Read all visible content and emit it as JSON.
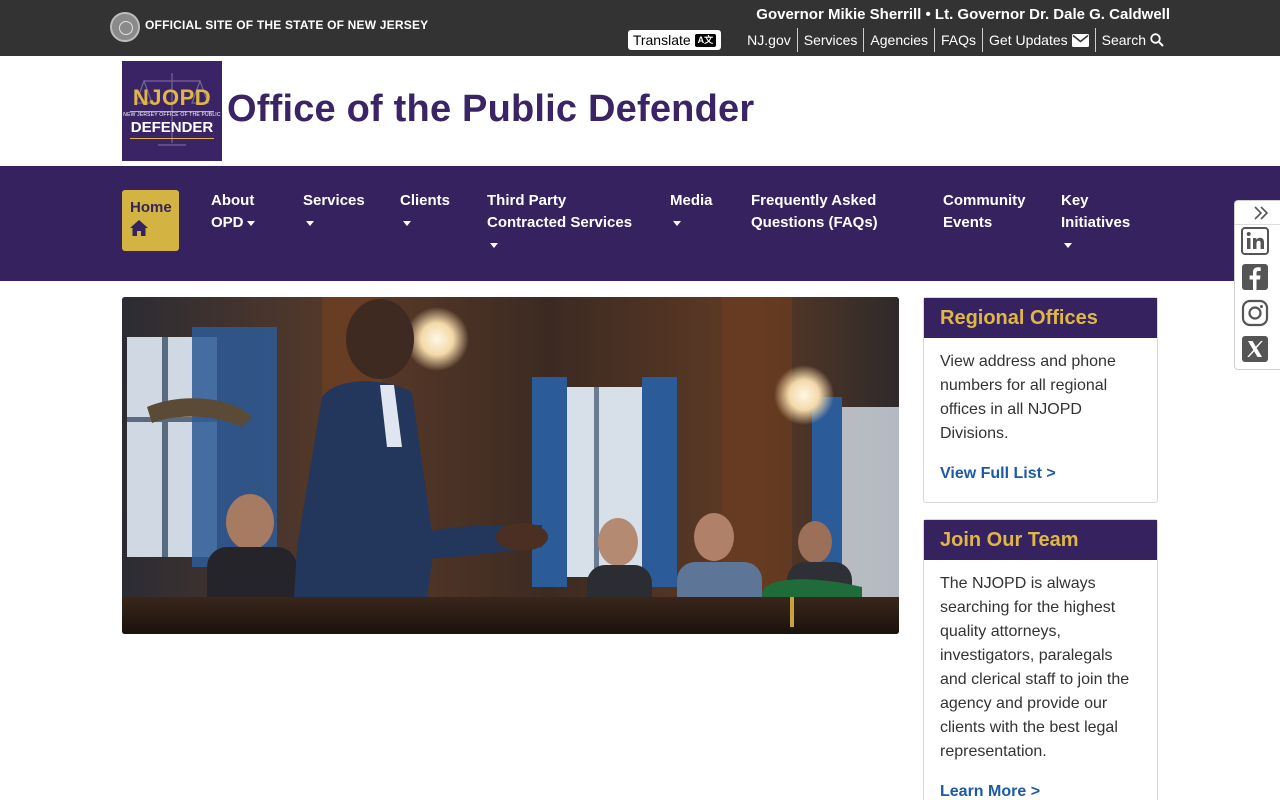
{
  "statebar": {
    "official_text": "OFFICIAL SITE OF THE STATE OF NEW JERSEY",
    "governor_text": "Governor Mikie Sherrill • Lt. Governor Dr. Dale G. Caldwell",
    "translate_label": "Translate",
    "translate_icon_text": "A文",
    "links": [
      "NJ.gov",
      "Services",
      "Agencies",
      "FAQs",
      "Get Updates",
      "Search"
    ]
  },
  "header": {
    "logo_line1": "NJOPD",
    "logo_line2": "NEW JERSEY OFFICE OF THE PUBLIC",
    "logo_line3": "DEFENDER",
    "title": "Office of the Public Defender"
  },
  "nav": {
    "home": "Home",
    "items": [
      {
        "line1": "About",
        "line2": "OPD"
      },
      {
        "line1": "Services"
      },
      {
        "line1": "Clients"
      },
      {
        "line1": "Third Party",
        "line2": "Contracted Services"
      },
      {
        "line1": "Media"
      },
      {
        "line1": "Frequently Asked",
        "line2": "Questions (FAQs)"
      },
      {
        "line1": "Community",
        "line2": "Events"
      },
      {
        "line1": "Key",
        "line2": "Initiatives"
      }
    ]
  },
  "cards": [
    {
      "title": "Regional Offices",
      "body": "View address and phone numbers for all regional offices in all NJOPD Divisions.",
      "link": "View Full List >"
    },
    {
      "title": "Join Our Team",
      "body": "The NJOPD is always searching for the highest quality attorneys, investigators, paralegals and clerical staff to join the agency and provide our clients with the best legal representation.",
      "link": "Learn More >"
    }
  ],
  "social": [
    "linkedin-icon",
    "facebook-icon",
    "instagram-icon",
    "x-icon"
  ],
  "colors": {
    "statebar": "#333333",
    "brand_purple": "#36225f",
    "gold": "#e0b746",
    "link_blue": "#1d5aa6"
  }
}
